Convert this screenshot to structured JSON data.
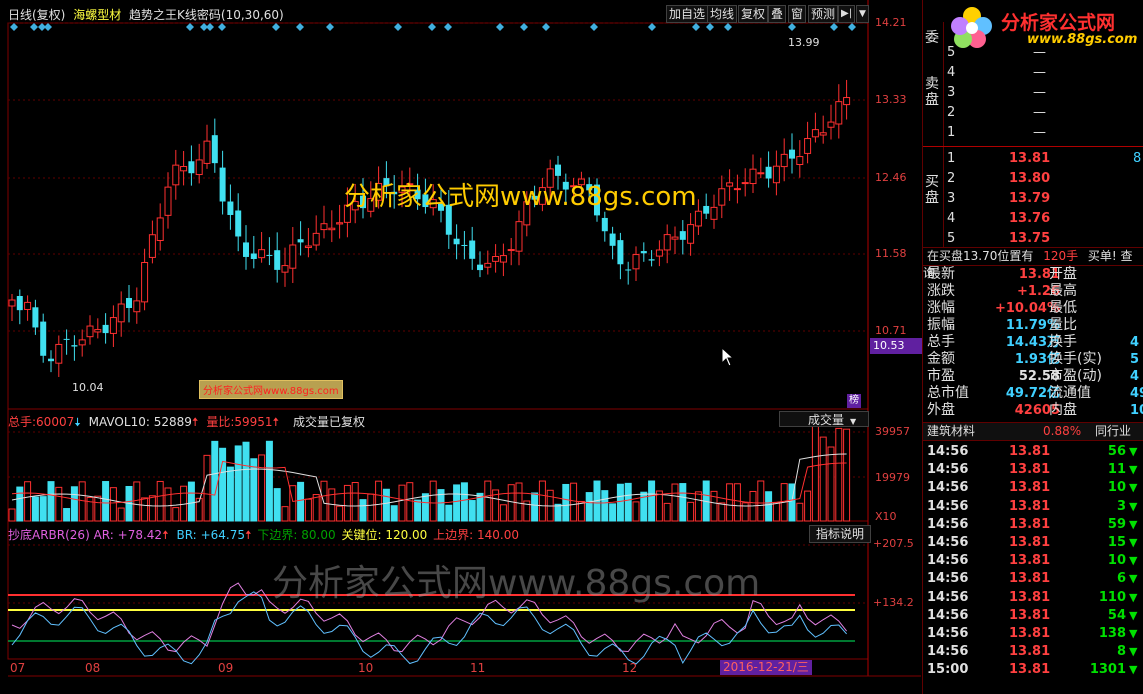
{
  "header": {
    "period": "日线(复权)",
    "stock_name": "海螺型材",
    "indicator": "趋势之王K线密码(10,30,60)"
  },
  "toolbar": {
    "add_fav": "加自选",
    "ma": "均线",
    "fq": "复权",
    "overlay": "叠",
    "window": "窗",
    "forecast": "预测",
    "arrow": "▶|",
    "dropdown": "▼"
  },
  "price_axis": [
    "14.21",
    "13.33",
    "12.46",
    "11.58",
    "10.71"
  ],
  "current_price_tag": "10.53",
  "high_marker": "13.99",
  "low_marker": "10.04",
  "watermark_big": "分析家公式网www.88gs.com",
  "watermark_small": "分析家公式网www.88gs.com",
  "watermark_arbr": "分析家公式网www.88gs.com",
  "rank_badge": "榜",
  "volume_panel": {
    "total_label": "总手:",
    "total_value": "60007",
    "mavol_label": "MAVOL10:",
    "mavol_value": "52889",
    "ratio_label": "量比:",
    "ratio_value": "59951",
    "note": "成交量已复权",
    "select": "成交量",
    "axis": [
      "39957",
      "19979",
      "X10"
    ]
  },
  "arbr_panel": {
    "name": "抄底ARBR(26)",
    "ar_label": "AR:",
    "ar_value": "+78.42",
    "br_label": "BR:",
    "br_value": "+64.75",
    "lower_label": "下边界:",
    "lower_value": "80.00",
    "key_label": "关键位:",
    "key_value": "120.00",
    "upper_label": "上边界:",
    "upper_value": "140.00",
    "help": "指标说明",
    "axis": [
      "+207.5",
      "+134.2"
    ]
  },
  "dates": [
    "07",
    "08",
    "09",
    "10",
    "11",
    "12"
  ],
  "cursor_date": "2016-12-21/三",
  "logo": {
    "text": "分析家公式网",
    "url": "www.88gs.com"
  },
  "order_book": {
    "wei_label": "委",
    "sell_label": "卖盘",
    "buy_label": "买盘",
    "sells": [
      {
        "level": "5",
        "price": "—"
      },
      {
        "level": "4",
        "price": "—"
      },
      {
        "level": "3",
        "price": "—"
      },
      {
        "level": "2",
        "price": "—"
      },
      {
        "level": "1",
        "price": "—"
      }
    ],
    "buys": [
      {
        "level": "1",
        "price": "13.81",
        "vol": "8"
      },
      {
        "level": "2",
        "price": "13.80",
        "vol": ""
      },
      {
        "level": "3",
        "price": "13.79",
        "vol": ""
      },
      {
        "level": "4",
        "price": "13.76",
        "vol": ""
      },
      {
        "level": "5",
        "price": "13.75",
        "vol": ""
      }
    ]
  },
  "info_bar": {
    "text": "在买盘13.70位置有",
    "qty": "120手",
    "action": "买单! 查询"
  },
  "quote": [
    {
      "l1": "最新",
      "v1": "13.81",
      "l2": "开盘",
      "v2": ""
    },
    {
      "l1": "涨跌",
      "v1": "+1.26",
      "l2": "最高",
      "v2": ""
    },
    {
      "l1": "涨幅",
      "v1": "+10.04%",
      "l2": "最低",
      "v2": ""
    },
    {
      "l1": "振幅",
      "v1": "11.79%",
      "l2": "量比",
      "v2": ""
    },
    {
      "l1": "总手",
      "v1": "14.43万",
      "l2": "换手",
      "v2": "4"
    },
    {
      "l1": "金额",
      "v1": "1.93亿",
      "l2": "换手(实)",
      "v2": "5"
    },
    {
      "l1": "市盈",
      "v1": "52.58",
      "l2": "市盈(动)",
      "v2": "4"
    },
    {
      "l1": "总市值",
      "v1": "49.72亿",
      "l2": "流通值",
      "v2": "49."
    },
    {
      "l1": "外盘",
      "v1": "42605",
      "l2": "内盘",
      "v2": "10."
    }
  ],
  "industry": {
    "name": "建筑材料",
    "change": "0.88%",
    "link": "同行业"
  },
  "ticks": [
    {
      "time": "14:56",
      "price": "13.81",
      "vol": "56"
    },
    {
      "time": "14:56",
      "price": "13.81",
      "vol": "11"
    },
    {
      "time": "14:56",
      "price": "13.81",
      "vol": "10"
    },
    {
      "time": "14:56",
      "price": "13.81",
      "vol": "3"
    },
    {
      "time": "14:56",
      "price": "13.81",
      "vol": "59"
    },
    {
      "time": "14:56",
      "price": "13.81",
      "vol": "15"
    },
    {
      "time": "14:56",
      "price": "13.81",
      "vol": "10"
    },
    {
      "time": "14:56",
      "price": "13.81",
      "vol": "6"
    },
    {
      "time": "14:56",
      "price": "13.81",
      "vol": "110"
    },
    {
      "time": "14:56",
      "price": "13.81",
      "vol": "54"
    },
    {
      "time": "14:56",
      "price": "13.81",
      "vol": "138"
    },
    {
      "time": "14:56",
      "price": "13.81",
      "vol": "8"
    },
    {
      "time": "15:00",
      "price": "13.81",
      "vol": "1301"
    }
  ]
}
